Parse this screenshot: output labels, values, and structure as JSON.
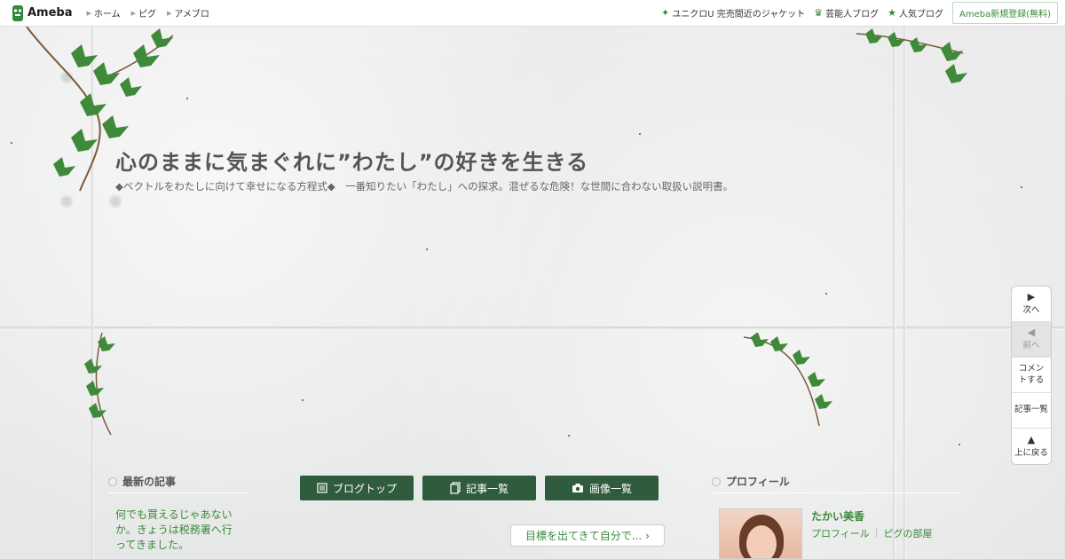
{
  "header": {
    "logo": "Ameba",
    "nav": [
      "ホーム",
      "ピグ",
      "アメブロ"
    ],
    "right_links": [
      {
        "label": "ユニクロU 完売間近のジャケット",
        "icon": "sparkle-icon"
      },
      {
        "label": "芸能人ブログ",
        "icon": "crown-icon"
      },
      {
        "label": "人気ブログ",
        "icon": "star-icon"
      }
    ],
    "register": "Ameba新規登録(無料)"
  },
  "blog": {
    "title": "心のままに気まぐれに”わたし”の好きを生きる",
    "description": "◆ベクトルをわたしに向けて幸せになる方程式◆　一番知りたい「わたし」への探求。混ぜるな危険！な世間に合わない取扱い説明書。"
  },
  "sidenav": {
    "next": "次へ",
    "prev": "前へ",
    "comment": "コメントする",
    "articles": "記事一覧",
    "top": "上に戻る"
  },
  "latest": {
    "heading": "最新の記事",
    "item": "何でも買えるじゃあないか。きょうは税務署へ行ってきました。"
  },
  "buttons": {
    "blog_top": "ブログトップ",
    "article_list": "記事一覧",
    "image_list": "画像一覧"
  },
  "next_article": "目標を出てきて自分で...",
  "profile": {
    "heading": "プロフィール",
    "name": "たかい美香",
    "link_profile": "プロフィール",
    "link_room": "ピグの部屋"
  },
  "colors": {
    "accent_green": "#2f5c3c",
    "link_green": "#3a8a3a"
  }
}
